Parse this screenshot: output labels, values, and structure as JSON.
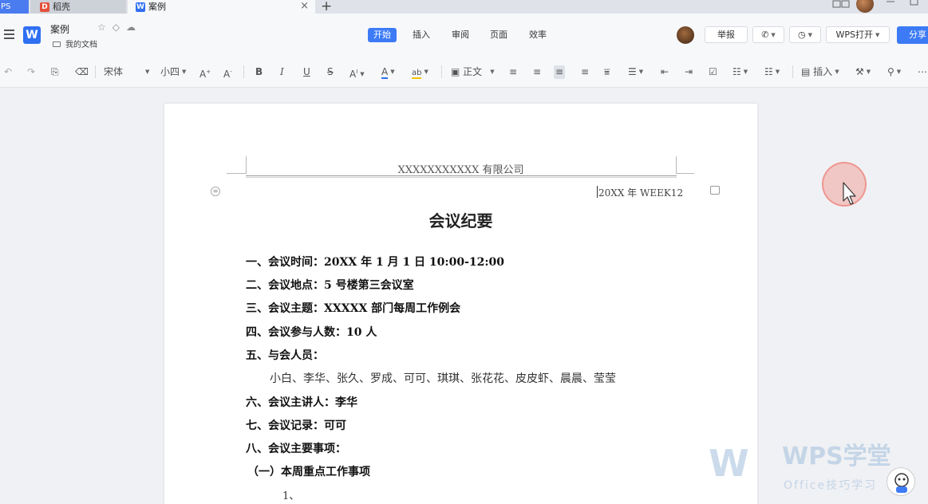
{
  "tabs": {
    "wps": "PS",
    "daoke": "稻壳",
    "doc": "案例",
    "close": "×",
    "add": "+"
  },
  "menubar": {
    "doc_name": "案例",
    "folder": "我的文档",
    "menus": [
      "开始",
      "插入",
      "审阅",
      "页面",
      "效率"
    ],
    "report": "举报",
    "wps_open": "WPS打开",
    "share": "分享"
  },
  "toolbar": {
    "font_name": "宋体",
    "font_size": "小四",
    "style": "正文",
    "insert": "插入"
  },
  "document": {
    "header_company": "XXXXXXXXXXX 有限公司",
    "header_week": "20XX 年 WEEK12",
    "title": "会议纪要",
    "lines": [
      "一、会议时间：20XX 年 1 月 1 日  10:00-12:00",
      "二、会议地点：5 号楼第三会议室",
      "三、会议主题：XXXXX 部门每周工作例会",
      "四、会议参与人数：10 人",
      "五、与会人员：",
      "小白、李华、张久、罗成、可可、琪琪、张花花、皮皮虾、晨晨、莹莹",
      "六、会议主讲人：李华",
      "七、会议记录：可可",
      "八、会议主要事项：",
      "（一）本周重点工作事项",
      "1、"
    ]
  },
  "watermark": {
    "title": "WPS学堂",
    "subtitle": "Office技巧学习"
  },
  "colors": {
    "accent": "#3d7bf6",
    "doc_icon": "#2f6ff1",
    "daoke_icon": "#e4513b"
  }
}
